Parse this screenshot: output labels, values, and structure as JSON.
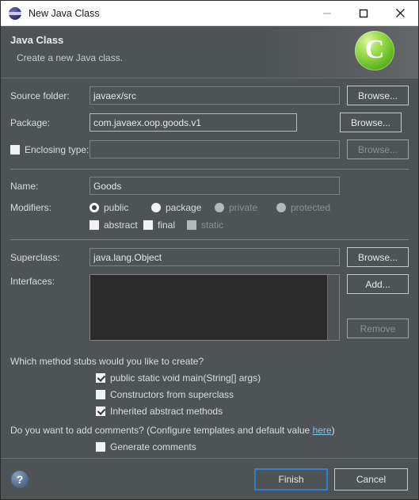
{
  "window": {
    "title": "New Java Class",
    "icon": "eclipse-icon",
    "controls": {
      "minimize": "minimize-icon",
      "maximize": "maximize-icon",
      "close": "close-icon"
    }
  },
  "banner": {
    "title": "Java Class",
    "subtitle": "Create a new Java class.",
    "art_letter": "C"
  },
  "form": {
    "source_folder": {
      "label": "Source folder:",
      "value": "javaex/src",
      "browse": "Browse..."
    },
    "package": {
      "label": "Package:",
      "value": "com.javaex.oop.goods.v1",
      "browse": "Browse..."
    },
    "enclosing_type": {
      "label": "Enclosing type:",
      "value": "",
      "checked": false,
      "browse": "Browse...",
      "browse_enabled": false
    },
    "name": {
      "label": "Name:",
      "value": "Goods"
    },
    "modifiers": {
      "label": "Modifiers:",
      "access": [
        {
          "label": "public",
          "selected": true,
          "enabled": true
        },
        {
          "label": "package",
          "selected": false,
          "enabled": true
        },
        {
          "label": "private",
          "selected": false,
          "enabled": false
        },
        {
          "label": "protected",
          "selected": false,
          "enabled": false
        }
      ],
      "flags": [
        {
          "label": "abstract",
          "checked": false,
          "enabled": true
        },
        {
          "label": "final",
          "checked": false,
          "enabled": true
        },
        {
          "label": "static",
          "checked": false,
          "enabled": false
        }
      ]
    },
    "superclass": {
      "label": "Superclass:",
      "value": "java.lang.Object",
      "browse": "Browse..."
    },
    "interfaces": {
      "label": "Interfaces:",
      "items": [],
      "add": "Add...",
      "remove": "Remove",
      "remove_enabled": false
    }
  },
  "stubs": {
    "question": "Which method stubs would you like to create?",
    "options": [
      {
        "label": "public static void main(String[] args)",
        "checked": true
      },
      {
        "label": "Constructors from superclass",
        "checked": false
      },
      {
        "label": "Inherited abstract methods",
        "checked": true
      }
    ]
  },
  "comments": {
    "question_prefix": "Do you want to add comments? (Configure templates and default value ",
    "link": "here",
    "question_suffix": ")",
    "option": {
      "label": "Generate comments",
      "checked": false
    }
  },
  "footer": {
    "help": "?",
    "finish": "Finish",
    "cancel": "Cancel"
  },
  "colors": {
    "dialog_bg": "#4e5356",
    "titlebar_bg": "#ffffff",
    "list_bg": "#2b2b2b",
    "text": "#dcdddd",
    "link": "#7ec6e8",
    "focus_border": "#2f7fd1",
    "accent_green": "#6cc029"
  }
}
